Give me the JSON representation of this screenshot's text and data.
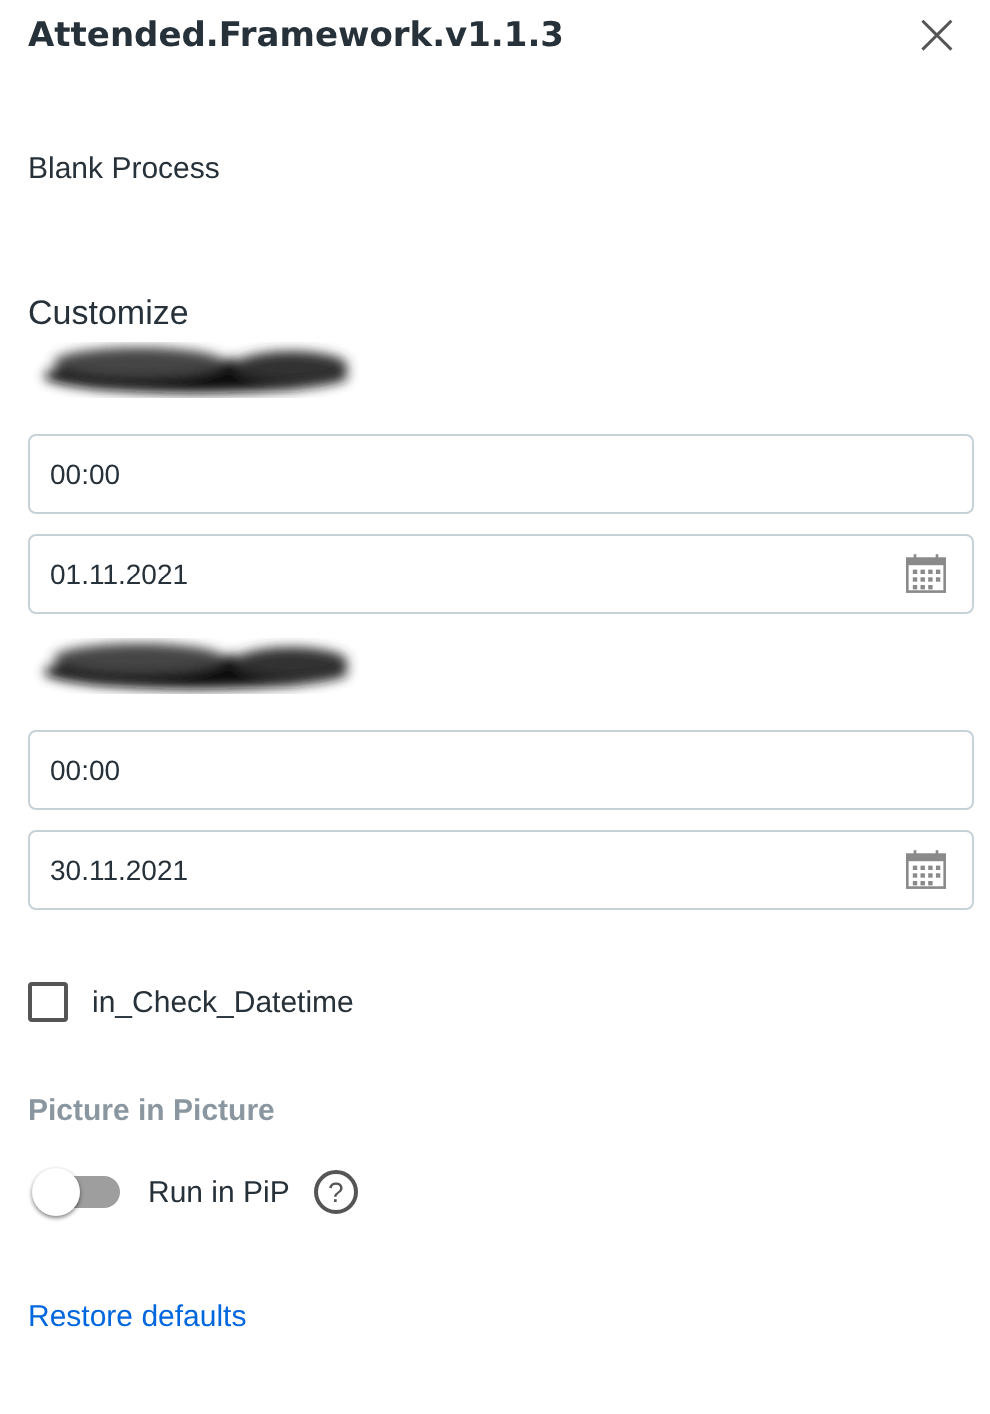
{
  "panel": {
    "title": "Attended.Framework.v1.1.3",
    "close": "×"
  },
  "process": "Blank Process",
  "section": "Customize",
  "groups": [
    {
      "label": {
        "kind": "redacted"
      },
      "fields": [
        {
          "kind": "text",
          "value": "00:00"
        },
        {
          "kind": "date",
          "value": "01.11.2021"
        }
      ]
    },
    {
      "label": {
        "kind": "redacted"
      },
      "fields": [
        {
          "kind": "text",
          "value": "00:00"
        },
        {
          "kind": "date",
          "value": "30.11.2021"
        }
      ]
    }
  ],
  "checkbox": {
    "label": "in_Check_Datetime",
    "checked": false
  },
  "pip": {
    "heading": "Picture in Picture",
    "toggle": {
      "label": "Run in PiP",
      "on": false
    },
    "help": "?"
  },
  "restore": "Restore defaults"
}
